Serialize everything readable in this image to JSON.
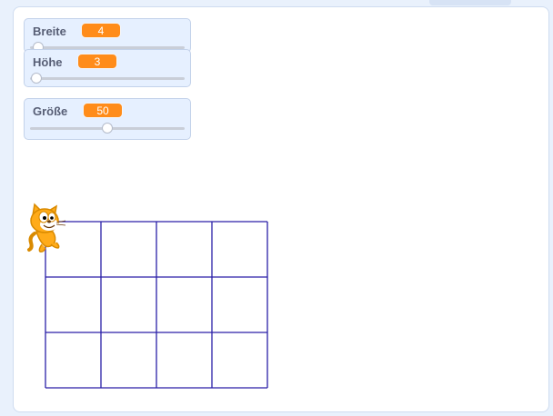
{
  "monitors": {
    "breite": {
      "label": "Breite",
      "value": "4",
      "level": 0.05
    },
    "hoehe": {
      "label": "Höhe",
      "value": "3",
      "level": 0.04
    },
    "groesse": {
      "label": "Größe",
      "value": "50",
      "level": 0.5
    }
  },
  "grid": {
    "columns": 4,
    "rows": 3,
    "line_color": "#2a1fa8"
  },
  "sprite": {
    "icon": "scratch-cat-sprite"
  }
}
